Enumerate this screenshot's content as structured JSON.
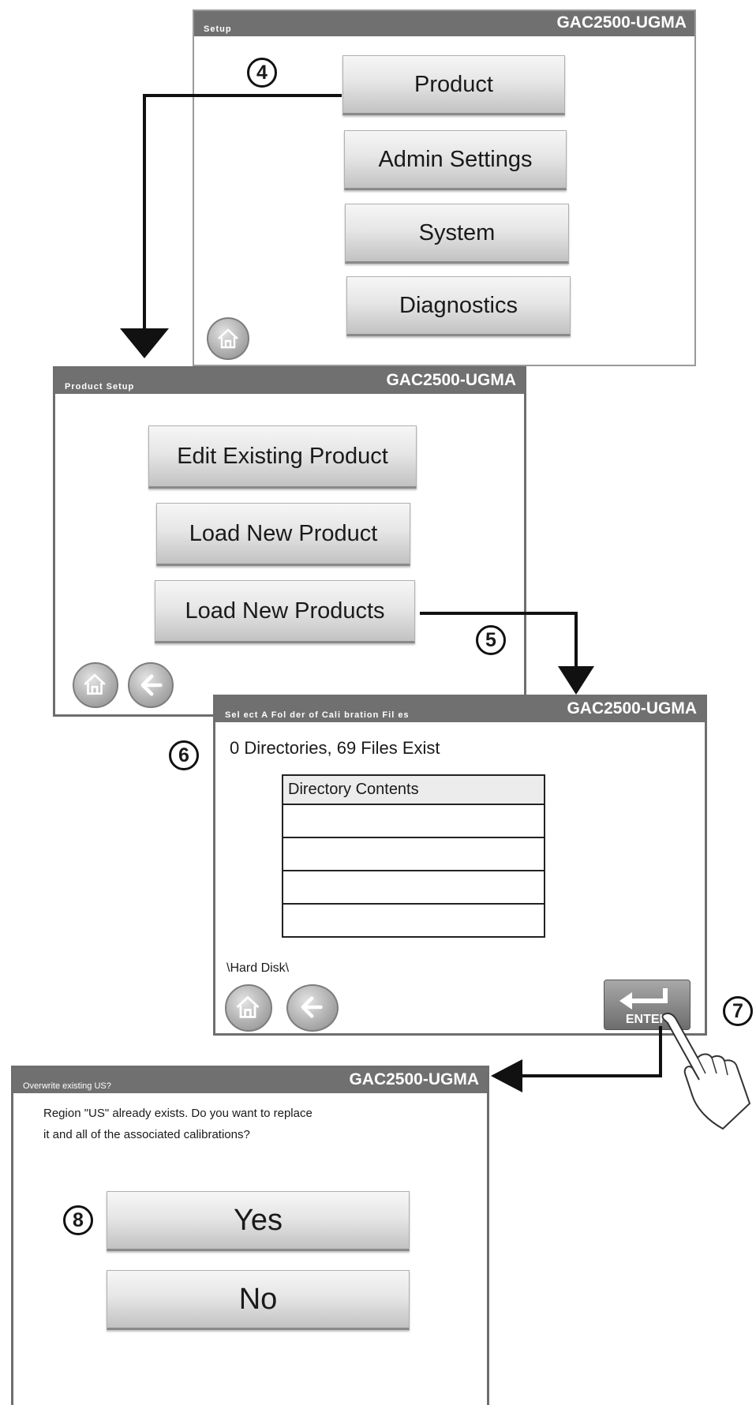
{
  "screen_setup": {
    "title_small": "Setup",
    "title_model": "GAC2500-UGMA",
    "buttons": [
      "Product",
      "Admin Settings",
      "System",
      "Diagnostics"
    ]
  },
  "screen_product_setup": {
    "title_small": "Product Setup",
    "title_model": "GAC2500-UGMA",
    "buttons": [
      "Edit Existing Product",
      "Load New Product",
      "Load New Products"
    ]
  },
  "screen_select_folder": {
    "title_small": "Sel ect A Fol der of Cali bration Fil es",
    "title_model": "GAC2500-UGMA",
    "status": "0 Directories, 69 Files Exist",
    "table_header": "Directory Contents",
    "table_rows": [
      "",
      "",
      "",
      ""
    ],
    "path": "\\Hard Disk\\",
    "enter_label": "ENTER"
  },
  "screen_overwrite": {
    "title_small": "Overwrite existing US?",
    "title_model": "GAC2500-UGMA",
    "message_line1": "Region \"US\" already exists. Do you want to replace",
    "message_line2": "it and all of the associated calibrations?",
    "yes_label": "Yes",
    "no_label": "No"
  },
  "steps": [
    "4",
    "5",
    "6",
    "7",
    "8"
  ],
  "icons": [
    "home-icon",
    "back-arrow-icon",
    "enter-icon",
    "pointing-hand-icon"
  ],
  "colors": {
    "titlebar": "#707070",
    "border": "#6e6e6e",
    "button_top": "#f6f6f6",
    "button_bottom": "#c2c2c2"
  }
}
